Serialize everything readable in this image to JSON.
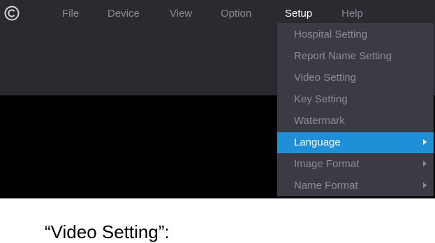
{
  "menubar": {
    "logo_icon": "copyright-circle-icon",
    "items": [
      {
        "label": "File"
      },
      {
        "label": "Device"
      },
      {
        "label": "View"
      },
      {
        "label": "Option"
      },
      {
        "label": "Setup"
      },
      {
        "label": "Help"
      }
    ],
    "active": "Setup"
  },
  "setup_menu": {
    "items": [
      {
        "label": "Hospital Setting"
      },
      {
        "label": "Report Name Setting"
      },
      {
        "label": "Video Setting"
      },
      {
        "label": "Key Setting"
      },
      {
        "label": "Watermark"
      },
      {
        "label": "Language"
      },
      {
        "label": "Image Format"
      },
      {
        "label": "Name Format"
      }
    ],
    "highlighted": "Language",
    "submenu_arrow_icon": "triangle-right-icon"
  },
  "caption": {
    "text": "“Video Setting”:"
  },
  "colors": {
    "menubar_bg": "#2a2b31",
    "menu_bg": "#3b3c43",
    "highlight": "#1f8fd8",
    "text_dim": "#8c8d93",
    "text_active": "#ffffff"
  }
}
